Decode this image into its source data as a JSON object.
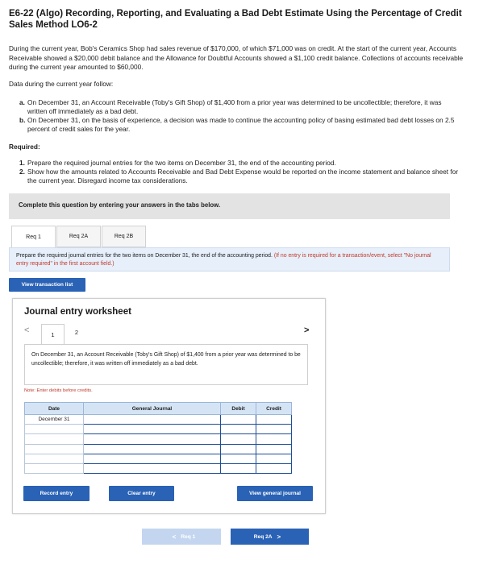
{
  "problem": {
    "title": "E6-22 (Algo) Recording, Reporting, and Evaluating a Bad Debt Estimate Using the Percentage of Credit Sales Method LO6-2",
    "intro": "During the current year, Bob's Ceramics Shop had sales revenue of $170,000, of which $71,000 was on credit. At the start of the current year, Accounts Receivable showed a $20,000 debit balance and the Allowance for Doubtful Accounts showed a $1,100 credit balance. Collections of accounts receivable during the current year amounted to $60,000.",
    "data_heading": "Data during the current year follow:",
    "items": [
      {
        "marker": "a.",
        "text": "On December 31, an Account Receivable (Toby's Gift Shop) of $1,400 from a prior year was determined to be uncollectible; therefore, it was written off immediately as a bad debt."
      },
      {
        "marker": "b.",
        "text": "On December 31, on the basis of experience, a decision was made to continue the accounting policy of basing estimated bad debt losses on 2.5 percent of credit sales for the year."
      }
    ],
    "required_heading": "Required:",
    "requirements": [
      {
        "marker": "1.",
        "text": "Prepare the required journal entries for the two items on December 31, the end of the accounting period."
      },
      {
        "marker": "2.",
        "text": "Show how the amounts related to Accounts Receivable and Bad Debt Expense would be reported on the income statement and balance sheet for the current year. Disregard income tax considerations."
      }
    ]
  },
  "instructions_bar": "Complete this question by entering your answers in the tabs below.",
  "tabs": [
    {
      "label": "Req 1",
      "active": true
    },
    {
      "label": "Req 2A",
      "active": false
    },
    {
      "label": "Req 2B",
      "active": false
    }
  ],
  "prepare_text": "Prepare the required journal entries for the two items on December 31, the end of the accounting period.",
  "prepare_hint": "(If no entry is required for a transaction/event, select \"No journal entry required\" in the first account field.)",
  "view_transaction_list": "View transaction list",
  "worksheet": {
    "title": "Journal entry worksheet",
    "pages": [
      "1",
      "2"
    ],
    "prev_arrow": "<",
    "next_arrow": ">",
    "scenario": "On December 31, an Account Receivable (Toby's Gift Shop) of $1,400 from a prior year was determined to be uncollectible; therefore, it was written off immediately as a bad debt.",
    "note": "Note: Enter debits before credits.",
    "table": {
      "headers": [
        "Date",
        "General Journal",
        "Debit",
        "Credit"
      ],
      "rows": [
        {
          "date": "December 31",
          "account": "",
          "debit": "",
          "credit": ""
        },
        {
          "date": "",
          "account": "",
          "debit": "",
          "credit": ""
        },
        {
          "date": "",
          "account": "",
          "debit": "",
          "credit": ""
        },
        {
          "date": "",
          "account": "",
          "debit": "",
          "credit": ""
        },
        {
          "date": "",
          "account": "",
          "debit": "",
          "credit": ""
        },
        {
          "date": "",
          "account": "",
          "debit": "",
          "credit": ""
        }
      ]
    },
    "record_entry": "Record entry",
    "clear_entry": "Clear entry",
    "view_general_journal": "View general journal"
  },
  "bottom_nav": {
    "prev_label": "Req 1",
    "next_label": "Req 2A",
    "prev_chevron": "<",
    "next_chevron": ">"
  },
  "colors": {
    "primary_button": "#2a62b5",
    "disabled_button": "#c4d6ef",
    "hint_red": "#c0392b",
    "info_box": "#e6effa",
    "table_header": "#d5e4f5"
  }
}
